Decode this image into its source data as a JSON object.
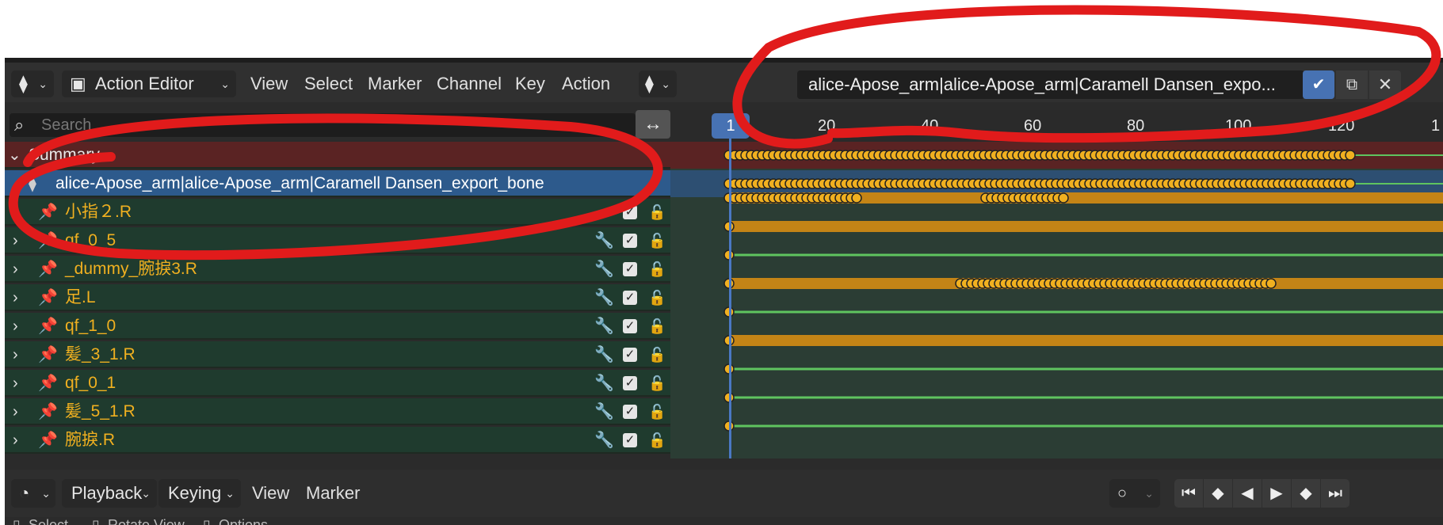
{
  "header": {
    "editor_type": "Action Editor",
    "menus": [
      "View",
      "Select",
      "Marker",
      "Channel",
      "Key",
      "Action"
    ],
    "action_name": "alice-Apose_arm|alice-Apose_arm|Caramell Dansen_expo...",
    "editor_icon": "dopesheet-icon",
    "mode_icon": "action-editor-icon"
  },
  "search": {
    "placeholder": "Search",
    "swap_icon": "swap-horizontal-icon"
  },
  "channels": {
    "summary": "Summary",
    "object": "alice-Apose_arm|alice-Apose_arm|Caramell Dansen_export_bone",
    "groups": [
      "小指２.R",
      "qf_0_5",
      "_dummy_腕捩3.R",
      "足.L",
      "qf_1_0",
      "髪_3_1.R",
      "qf_0_1",
      "髪_5_1.R",
      "腕捩.R"
    ]
  },
  "timeline": {
    "current_frame": "1",
    "ticks": [
      "20",
      "40",
      "60",
      "80",
      "100",
      "120",
      "1"
    ]
  },
  "footer": {
    "playback": "Playback",
    "keying": "Keying",
    "menus": [
      "View",
      "Marker"
    ]
  },
  "status": {
    "select": "Select",
    "rotate": "Rotate View",
    "options": "Options"
  },
  "colors": {
    "accent": "#4772b3",
    "keyframe": "#f0b020",
    "channel_bg": "#1f3b2e",
    "annotation": "#e11b1b"
  }
}
